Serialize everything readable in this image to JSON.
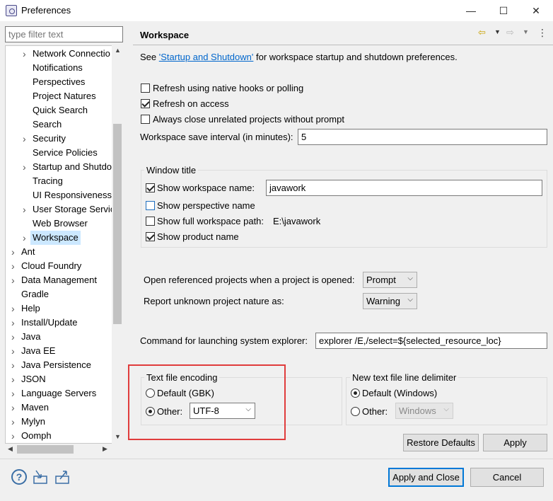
{
  "window": {
    "title": "Preferences",
    "minimize_glyph": "—",
    "maximize_glyph": "☐",
    "close_glyph": "✕"
  },
  "sidebar": {
    "filter_placeholder": "type filter text",
    "items": [
      {
        "label": "Network Connectio",
        "expandable": true,
        "indent": 1
      },
      {
        "label": "Notifications",
        "expandable": false,
        "indent": 1
      },
      {
        "label": "Perspectives",
        "expandable": false,
        "indent": 1
      },
      {
        "label": "Project Natures",
        "expandable": false,
        "indent": 1
      },
      {
        "label": "Quick Search",
        "expandable": false,
        "indent": 1
      },
      {
        "label": "Search",
        "expandable": false,
        "indent": 1
      },
      {
        "label": "Security",
        "expandable": true,
        "indent": 1
      },
      {
        "label": "Service Policies",
        "expandable": false,
        "indent": 1
      },
      {
        "label": "Startup and Shutdo",
        "expandable": true,
        "indent": 1
      },
      {
        "label": "Tracing",
        "expandable": false,
        "indent": 1
      },
      {
        "label": "UI Responsiveness",
        "expandable": false,
        "indent": 1
      },
      {
        "label": "User Storage Servic",
        "expandable": true,
        "indent": 1
      },
      {
        "label": "Web Browser",
        "expandable": false,
        "indent": 1
      },
      {
        "label": "Workspace",
        "expandable": true,
        "indent": 1,
        "selected": true
      },
      {
        "label": "Ant",
        "expandable": true,
        "indent": 0
      },
      {
        "label": "Cloud Foundry",
        "expandable": true,
        "indent": 0
      },
      {
        "label": "Data Management",
        "expandable": true,
        "indent": 0
      },
      {
        "label": "Gradle",
        "expandable": false,
        "indent": 0
      },
      {
        "label": "Help",
        "expandable": true,
        "indent": 0
      },
      {
        "label": "Install/Update",
        "expandable": true,
        "indent": 0
      },
      {
        "label": "Java",
        "expandable": true,
        "indent": 0
      },
      {
        "label": "Java EE",
        "expandable": true,
        "indent": 0
      },
      {
        "label": "Java Persistence",
        "expandable": true,
        "indent": 0
      },
      {
        "label": "JSON",
        "expandable": true,
        "indent": 0
      },
      {
        "label": "Language Servers",
        "expandable": true,
        "indent": 0
      },
      {
        "label": "Maven",
        "expandable": true,
        "indent": 0
      },
      {
        "label": "Mylyn",
        "expandable": true,
        "indent": 0
      },
      {
        "label": "Oomph",
        "expandable": true,
        "indent": 0
      }
    ]
  },
  "main": {
    "title": "Workspace",
    "intro_prefix": "See ",
    "intro_link": "'Startup and Shutdown'",
    "intro_suffix": " for workspace startup and shutdown preferences.",
    "refresh_native": {
      "label": "Refresh using native hooks or polling",
      "checked": false
    },
    "refresh_access": {
      "label": "Refresh on access",
      "checked": true
    },
    "always_close": {
      "label": "Always close unrelated projects without prompt",
      "checked": false
    },
    "save_interval_label": "Workspace save interval (in minutes):",
    "save_interval_value": "5",
    "window_title": {
      "group_label": "Window title",
      "show_workspace_name": {
        "label": "Show workspace name:",
        "checked": true,
        "value": "javawork"
      },
      "show_perspective_name": {
        "label": "Show perspective name",
        "checked": false
      },
      "show_full_path": {
        "label": "Show full workspace path:",
        "checked": false,
        "value": "E:\\javawork"
      },
      "show_product_name": {
        "label": "Show product name",
        "checked": true
      }
    },
    "open_referenced_label": "Open referenced projects when a project is opened:",
    "open_referenced_value": "Prompt",
    "unknown_nature_label": "Report unknown project nature as:",
    "unknown_nature_value": "Warning",
    "explorer_label": "Command for launching system explorer:",
    "explorer_value": "explorer /E,/select=${selected_resource_loc}",
    "encoding": {
      "group_label": "Text file encoding",
      "default_label": "Default (GBK)",
      "other_label": "Other:",
      "other_value": "UTF-8",
      "selected": "other"
    },
    "line_delimiter": {
      "group_label": "New text file line delimiter",
      "default_label": "Default (Windows)",
      "other_label": "Other:",
      "other_value": "Windows",
      "selected": "default"
    },
    "restore_defaults_label": "Restore Defaults",
    "apply_label": "Apply"
  },
  "footer": {
    "apply_close_label": "Apply and Close",
    "cancel_label": "Cancel"
  },
  "colors": {
    "highlight_box": "#e03c3c",
    "selection": "#cce8ff",
    "link": "#0066cc"
  }
}
